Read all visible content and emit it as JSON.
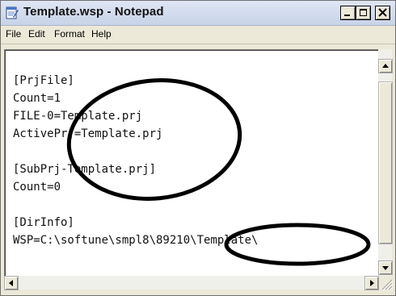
{
  "window": {
    "title": "Template.wsp - Notepad"
  },
  "menu": {
    "items": [
      {
        "label": "File"
      },
      {
        "label": "Edit"
      },
      {
        "label": "Format"
      },
      {
        "label": "Help"
      }
    ]
  },
  "editor": {
    "lines": [
      "[PrjFile]",
      "Count=1",
      "FILE-0=Template.prj",
      "ActivePrj=Template.prj",
      "",
      "[SubPrj-Template.prj]",
      "Count=0",
      "",
      "[DirInfo]",
      "WSP=C:\\softune\\smpl8\\89210\\Template\\"
    ]
  },
  "icons": {
    "app": "notepad-icon",
    "minimize": "minimize-icon",
    "maximize": "maximize-icon",
    "close": "close-icon"
  },
  "colors": {
    "annotation": "#000000",
    "titlebar": "#c8d3e8"
  }
}
